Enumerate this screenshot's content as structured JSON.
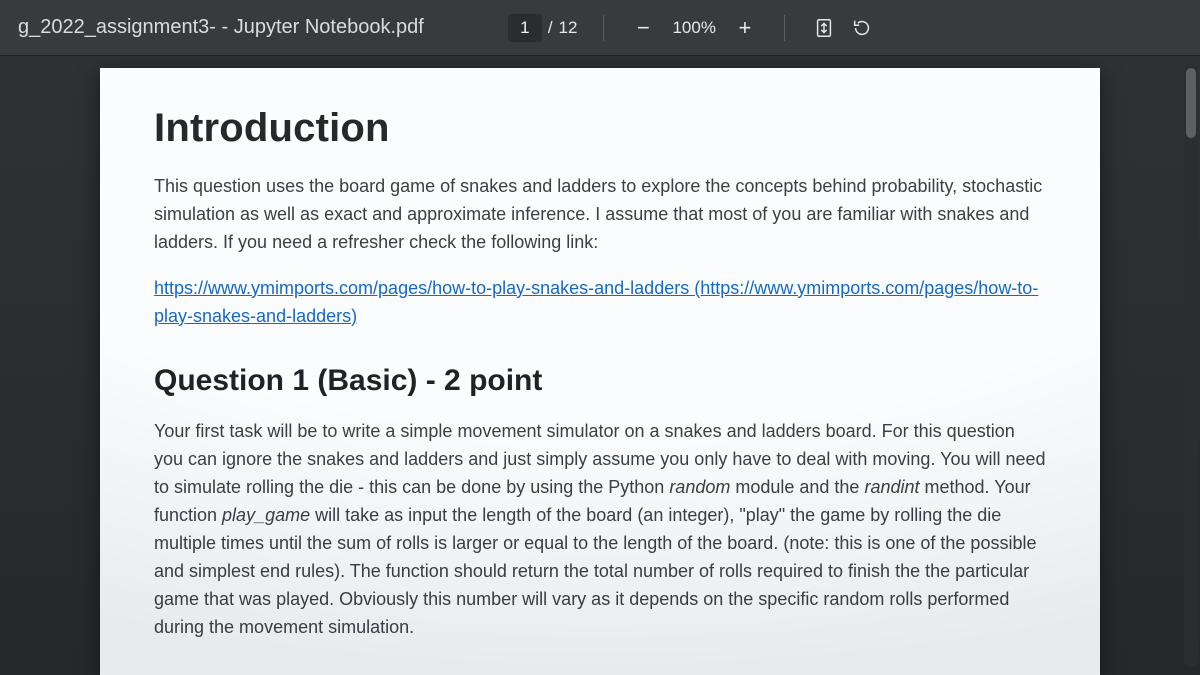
{
  "toolbar": {
    "doc_title": "g_2022_assignment3- - Jupyter Notebook.pdf",
    "page_current": "1",
    "page_sep": "/",
    "page_total": "12",
    "zoom_minus": "−",
    "zoom_level": "100%",
    "zoom_plus": "+"
  },
  "document": {
    "intro_heading": "Introduction",
    "intro_para": "This question uses the board game of snakes and ladders to explore the concepts behind probability, stochastic simulation as well as exact and approximate inference. I assume that most of you are familiar with snakes and ladders. If you need a refresher check the following link:",
    "link_text": "https://www.ymimports.com/pages/how-to-play-snakes-and-ladders (https://www.ymimports.com/pages/how-to-play-snakes-and-ladders)",
    "q1_heading": "Question 1 (Basic) - 2 point",
    "q1_para_a": "Your first task will be to write a simple movement simulator on a snakes and ladders board. For this question you can ignore the snakes and ladders and just simply assume you only have to deal with moving. You will need to simulate rolling the die - this can be done by using the Python ",
    "q1_random": "random",
    "q1_para_b": " module and the ",
    "q1_randint": "randint",
    "q1_para_c": " method. Your function ",
    "q1_playgame": "play_game",
    "q1_para_d": " will take as input the length of the board (an integer), \"play\" the game by rolling the die multiple times until the sum of rolls is larger or equal to the length of the board. (note: this is one of the possible and simplest end rules). The function should return the total number of rolls required to finish the the particular game that was played. Obviously this number will vary as it depends on the specific random rolls performed during the movement simulation."
  }
}
